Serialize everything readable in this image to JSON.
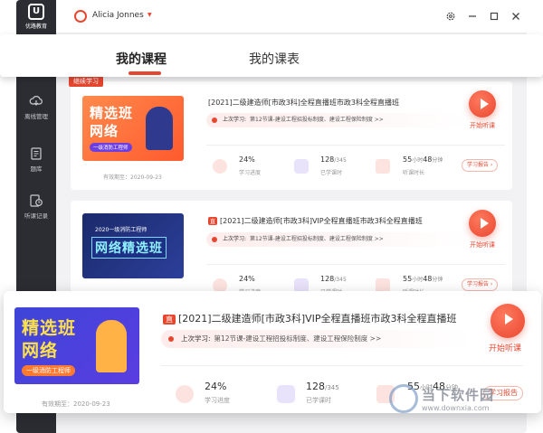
{
  "app": {
    "logo_text": "优路教育",
    "logo_mark": "U",
    "user_name": "Alicia Jonnes",
    "brand_color": "#e8472f"
  },
  "sidebar": {
    "items": [
      {
        "label": "离线管理",
        "icon": "cloud-download-icon"
      },
      {
        "label": "题库",
        "icon": "document-icon"
      },
      {
        "label": "听课记录",
        "icon": "clock-record-icon"
      }
    ]
  },
  "tabs": [
    {
      "label": "我的课程",
      "active": true
    },
    {
      "label": "我的课表",
      "active": false
    }
  ],
  "continue_tag": "继续学习",
  "courses": [
    {
      "thumb_title": "精选班\n网络",
      "thumb_line1": "精选班",
      "thumb_line2": "网络",
      "thumb_sub": "一级消防工程师",
      "title": "[2021]二级建造师[市政3科]全程直播班市政3科全程直播班",
      "last_label": "上次学习:",
      "last_text": "第12节课-建设工程招投标制度、建设工程保险制度 >>",
      "valid": "有效期至：2020-09-23",
      "progress": "24%",
      "progress_label": "学习进度",
      "lessons": "128",
      "lessons_total": "/345",
      "lessons_label": "已学课时",
      "duration": "55小时48分钟",
      "duration_h": "55",
      "duration_h_unit": "小时",
      "duration_m": "48",
      "duration_m_unit": "分钟",
      "duration_label": "听课时长",
      "report": "学习报告",
      "play_label": "开始听课"
    },
    {
      "thumb_line0": "2020一级消防工程师",
      "thumb_line1": "网络精选班",
      "vip": "直",
      "title": "[2021]二级建造师[市政3科]VIP全程直播班市政3科全程直播班",
      "last_label": "上次学习:",
      "last_text": "第12节课-建设工程招投标制度、建设工程保险制度 >>",
      "progress": "24%",
      "progress_label": "学习进度",
      "lessons": "128",
      "lessons_total": "/345",
      "lessons_label": "已学课时",
      "duration_h": "55",
      "duration_h_unit": "小时",
      "duration_m": "48",
      "duration_m_unit": "分钟",
      "duration_label": "听课时长",
      "report": "学习报告",
      "play_label": "开始听课"
    },
    {
      "thumb_line1": "精选班",
      "thumb_line2": "网络",
      "thumb_sub": "一级消防工程师",
      "vip": "直",
      "title": "[2021]二级建造师[市政3科]VIP全程直播班市政3科全程直播班",
      "last_label": "上次学习:",
      "last_text": "第12节课-建设工程招投标制度、建设工程保险制度 >>",
      "valid": "有效期至：2020-09-23",
      "progress": "24%",
      "progress_label": "学习进度",
      "lessons": "128",
      "lessons_total": "/345",
      "lessons_label": "已学课时",
      "duration_h": "55",
      "duration_h_unit": "小时",
      "duration_m": "48",
      "duration_m_unit": "分钟",
      "report": "学习报告",
      "play_label": "开始听课"
    }
  ],
  "watermark": {
    "line1": "当下软件园",
    "line2": "www.downxia.com"
  }
}
